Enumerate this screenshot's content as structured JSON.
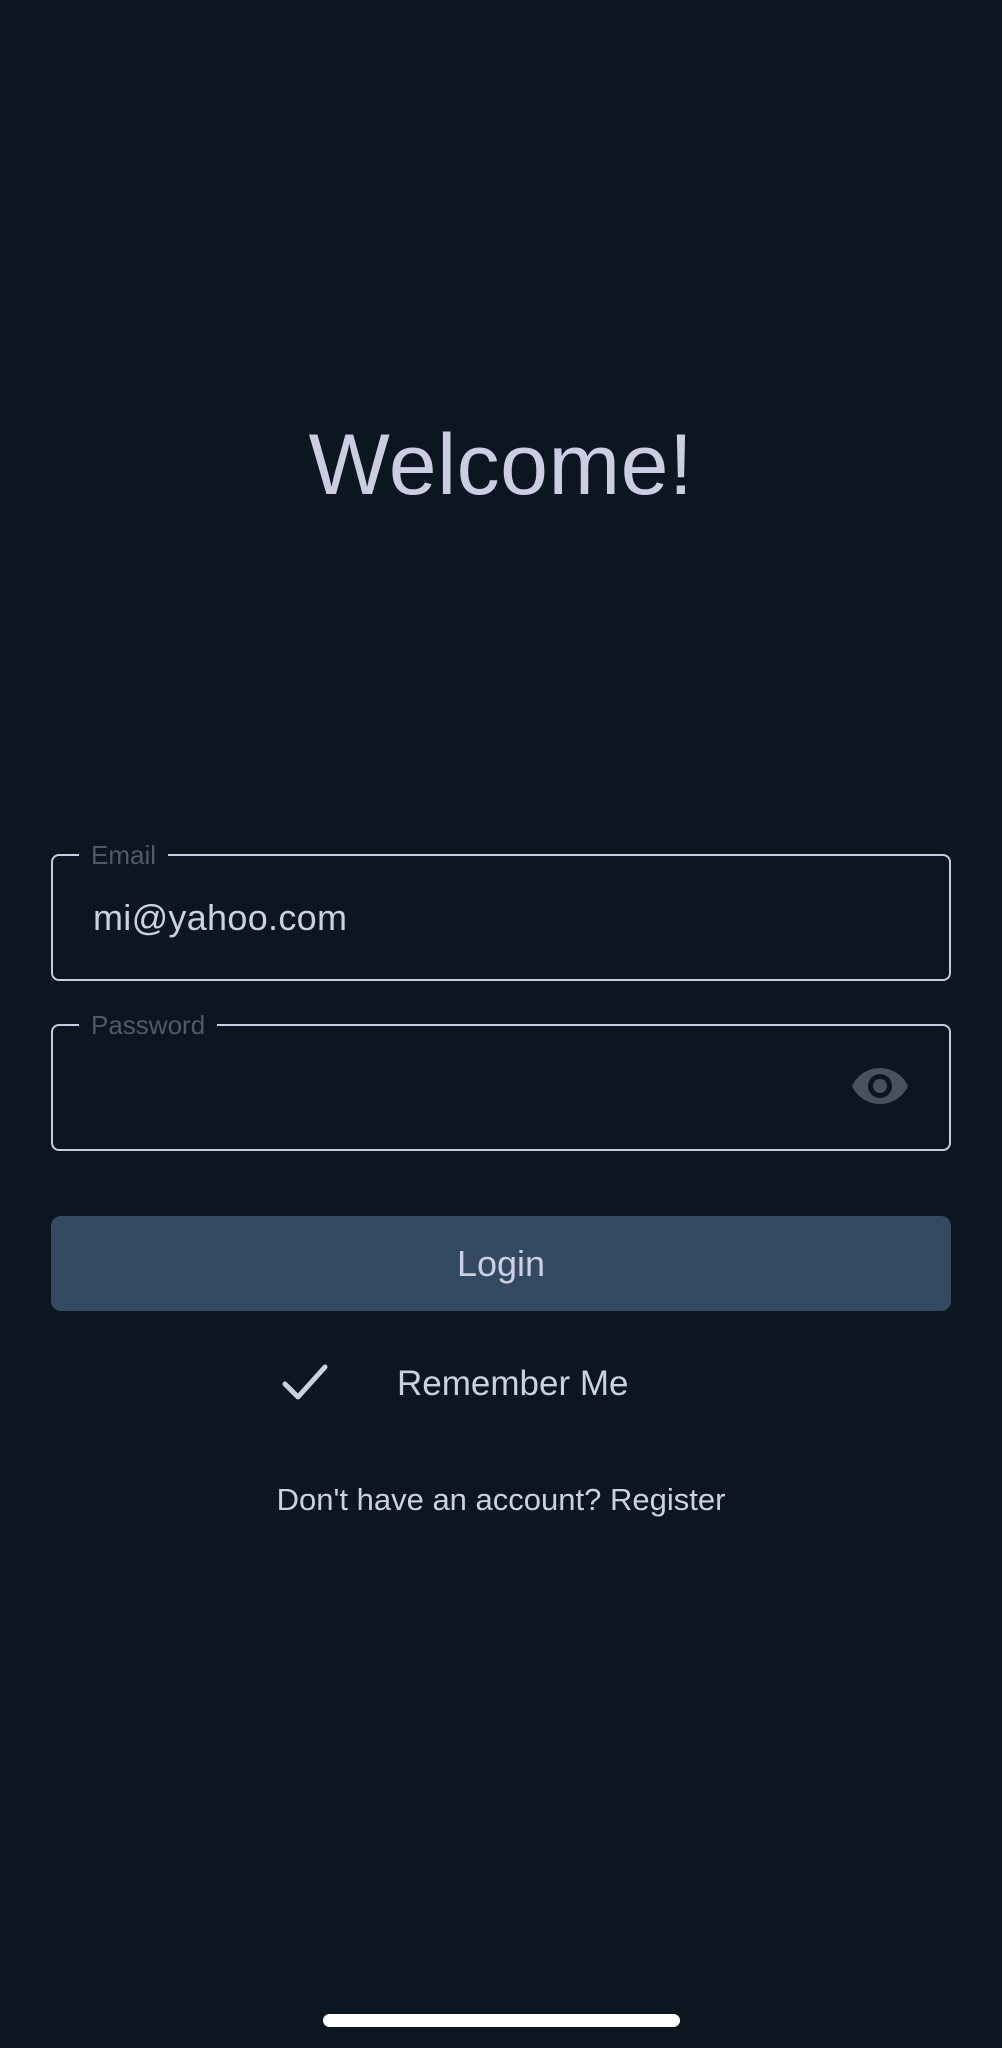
{
  "screen": {
    "title": "Welcome!"
  },
  "form": {
    "email": {
      "label": "Email",
      "value": "mi@yahoo.com"
    },
    "password": {
      "label": "Password",
      "value": "",
      "toggle_icon": "eye-icon"
    },
    "login_label": "Login",
    "remember_me": {
      "label": "Remember Me",
      "checked": true,
      "icon": "check-icon"
    },
    "register_text": "Don't have an account? Register"
  },
  "colors": {
    "background": "#0c1620",
    "button": "#344a62",
    "text": "#cdd0e2",
    "label": "#4f5968",
    "border": "#c9cbe0"
  }
}
